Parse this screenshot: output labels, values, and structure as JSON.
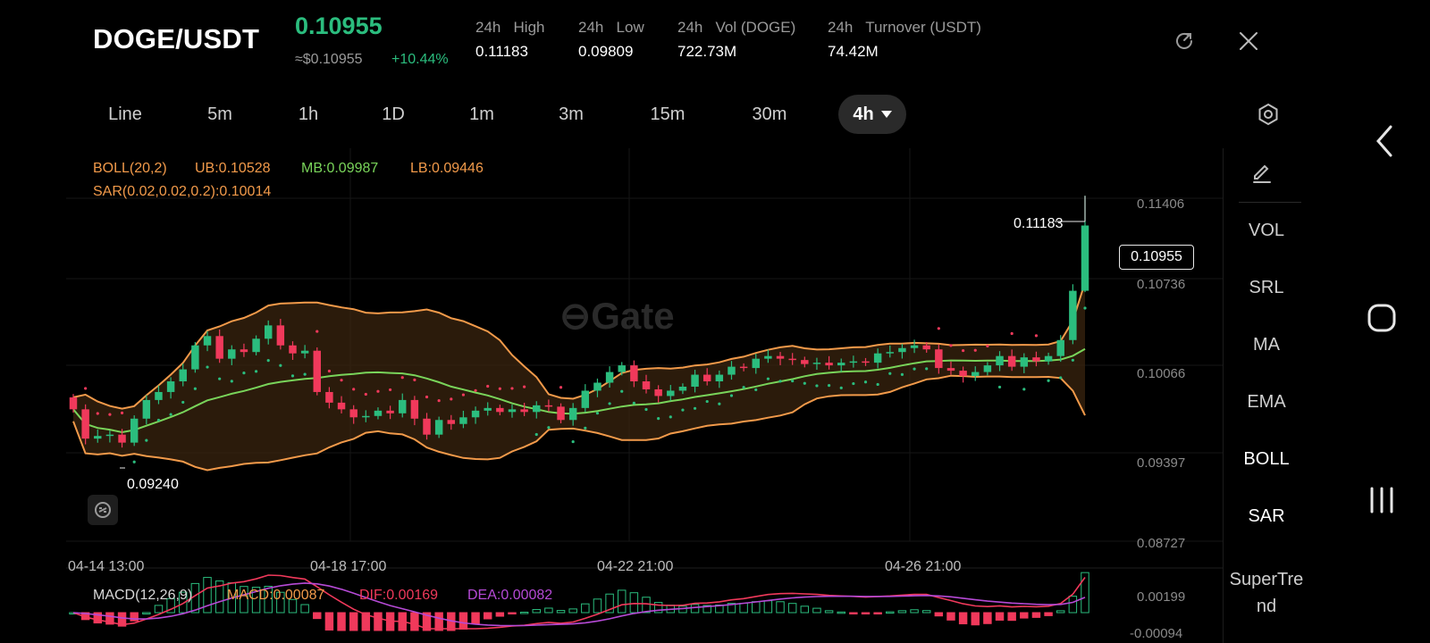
{
  "header": {
    "pair": "DOGE/USDT",
    "last_price": "0.10955",
    "fiat_price": "≈$0.10955",
    "change_pct": "+10.44%",
    "stats": [
      {
        "label": "24h   High",
        "value": "0.11183"
      },
      {
        "label": "24h   Low",
        "value": "0.09809"
      },
      {
        "label": "24h   Vol (DOGE)",
        "value": "722.73M"
      },
      {
        "label": "24h   Turnover (USDT)",
        "value": "74.42M"
      }
    ],
    "icons": {
      "refresh": "refresh-icon",
      "close": "close-icon"
    }
  },
  "intervals": {
    "tabs": [
      "Line",
      "5m",
      "1h",
      "1D",
      "1m",
      "3m",
      "15m",
      "30m",
      "4h"
    ],
    "active": "4h",
    "settings_icon": "settings-icon"
  },
  "legend": {
    "boll": "BOLL(20,2)",
    "ub": "UB:0.10528",
    "mb": "MB:0.09987",
    "lb": "LB:0.09446",
    "sar": "SAR(0.02,0.02,0.2):0.10014",
    "macd": "MACD(12,26,9)",
    "macd_val": "MACD:0.00087",
    "dif": "DIF:0.00169",
    "dea": "DEA:0.00082"
  },
  "watermark": "Gate",
  "annotations": {
    "high_marker": "0.11183",
    "low_marker": "0.09240",
    "current_price": "0.10955"
  },
  "colors": {
    "up": "#2bbd7e",
    "down": "#f0395b",
    "ub": "#f29a4a",
    "mb": "#79d45a",
    "lb": "#f29a4a",
    "sar": "#f0395b",
    "dif": "#f0395b",
    "dea": "#b64ad6",
    "macd_label": "#f29a4a"
  },
  "sidebar": {
    "edit_icon": "pencil-icon",
    "items": [
      {
        "label": "VOL",
        "on": false
      },
      {
        "label": "SRL",
        "on": false
      },
      {
        "label": "MA",
        "on": false
      },
      {
        "label": "EMA",
        "on": false
      },
      {
        "label": "BOLL",
        "on": true
      },
      {
        "label": "SAR",
        "on": true
      },
      {
        "label": "SuperTre nd",
        "on": false
      }
    ]
  },
  "chart_data": {
    "type": "candlestick",
    "y_ticks": [
      "0.11406",
      "0.10736",
      "0.10066",
      "0.09397",
      "0.08727"
    ],
    "ylim": [
      0.0859,
      0.1154
    ],
    "x_ticks": [
      "04-14 13:00",
      "04-18 17:00",
      "04-22 21:00",
      "04-26 21:00"
    ],
    "macd_y_ticks": [
      "0.00199",
      "-0.00094"
    ],
    "closes": [
      0.0958,
      0.0936,
      0.0938,
      0.0939,
      0.0933,
      0.0951,
      0.0965,
      0.0971,
      0.0979,
      0.0988,
      0.1006,
      0.1013,
      0.0996,
      0.1003,
      0.1001,
      0.1011,
      0.1021,
      0.1006,
      0.1,
      0.1002,
      0.0971,
      0.0963,
      0.0958,
      0.0952,
      0.0953,
      0.0957,
      0.0955,
      0.0965,
      0.0951,
      0.0939,
      0.095,
      0.0947,
      0.0952,
      0.0957,
      0.0959,
      0.0956,
      0.0958,
      0.0956,
      0.0961,
      0.096,
      0.095,
      0.0959,
      0.0972,
      0.0978,
      0.0986,
      0.0991,
      0.0979,
      0.0973,
      0.0968,
      0.0972,
      0.0975,
      0.0984,
      0.0979,
      0.0984,
      0.099,
      0.0989,
      0.0996,
      0.0998,
      0.0996,
      0.0995,
      0.0992,
      0.0993,
      0.0991,
      0.0993,
      0.0994,
      0.0993,
      0.1,
      0.1001,
      0.1004,
      0.1006,
      0.1003,
      0.0989,
      0.0987,
      0.0983,
      0.0986,
      0.0991,
      0.0998,
      0.099,
      0.0997,
      0.0994,
      0.0998,
      0.101,
      0.1047,
      0.1096
    ]
  }
}
